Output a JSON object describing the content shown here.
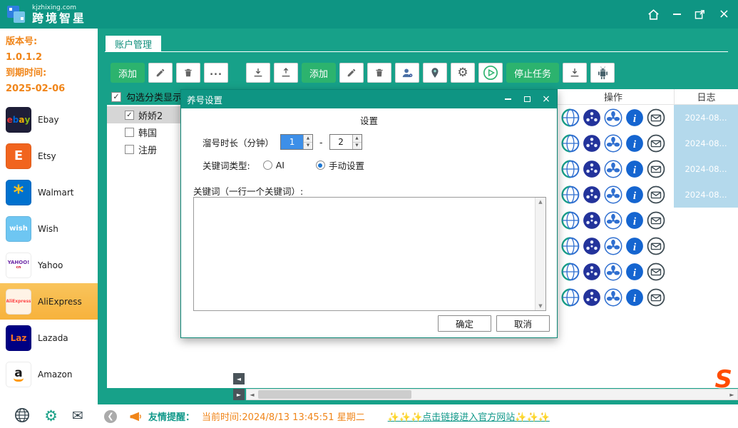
{
  "colors": {
    "teal": "#0e9583",
    "main-bg": "#17a189",
    "green": "#2cb36e",
    "orange": "#f08519",
    "highlight": "#f7b23c",
    "row-date-bg": "#b4d9ec"
  },
  "titlebar": {
    "site": "kjzhixing.com",
    "app_name": "跨境智星"
  },
  "sidebar": {
    "version_label": "版本号:",
    "version": "1.0.1.2",
    "expiry_label": "到期时间:",
    "expiry": "2025-02-06",
    "platforms": [
      {
        "label": "Ebay",
        "icon": "ebay-logo",
        "bg": "#1e1e38",
        "size": 12,
        "letters": [
          [
            "e",
            "#e53238"
          ],
          [
            "b",
            "#0064d2"
          ],
          [
            "a",
            "#f5af02"
          ],
          [
            "y",
            "#86b817"
          ]
        ]
      },
      {
        "label": "Etsy",
        "icon": "etsy-logo",
        "bg": "#f1641e",
        "size": 18,
        "letters": [
          [
            "E",
            "#ffffff"
          ]
        ]
      },
      {
        "label": "Walmart",
        "icon": "walmart-logo",
        "bg": "#0071ce",
        "size": 28,
        "letters": [
          [
            "*",
            "#ffc220"
          ]
        ]
      },
      {
        "label": "Wish",
        "icon": "wish-logo",
        "bg": "#6ec6f2",
        "size": 10,
        "letters": [
          [
            "wish",
            "#ffffff"
          ]
        ]
      },
      {
        "label": "Yahoo",
        "icon": "yahoo-logo",
        "bg": "#ffffff",
        "size": 7,
        "letters": [
          [
            "YAHOO!",
            "#6f2da8"
          ]
        ],
        "sub": [
          "cn",
          "#d0021b"
        ]
      },
      {
        "label": "AliExpress",
        "icon": "aliexpress-logo",
        "bg": "#fff3e6",
        "size": 6,
        "letters": [
          [
            "AliExpress",
            "#ff4747"
          ]
        ],
        "selected": true
      },
      {
        "label": "Lazada",
        "icon": "lazada-logo",
        "bg": "#000083",
        "size": 12,
        "letters": [
          [
            "Laz",
            "#f57224"
          ]
        ]
      },
      {
        "label": "Amazon",
        "icon": "amazon-logo",
        "bg": "#ffffff",
        "size": 17,
        "letters": [
          [
            "a",
            "#1a1a1a"
          ]
        ],
        "smile": true
      }
    ]
  },
  "main": {
    "tab": "账户管理",
    "filter_checkbox_label": "勾选分类显示",
    "toolbar_category": {
      "buttons": [
        {
          "name": "add-category-button",
          "style": "green",
          "label": "添加"
        },
        {
          "name": "edit-category-button",
          "icon": "pencil-icon"
        },
        {
          "name": "delete-category-button",
          "icon": "trash-icon"
        },
        {
          "name": "more-category-button",
          "icon": "more-icon"
        }
      ]
    },
    "toolbar_account": {
      "buttons": [
        {
          "name": "import-button",
          "icon": "download-icon"
        },
        {
          "name": "export-button",
          "icon": "upload-icon"
        },
        {
          "name": "add-account-button",
          "style": "green",
          "label": "添加"
        },
        {
          "name": "edit-account-button",
          "icon": "pencil-icon"
        },
        {
          "name": "delete-account-button",
          "icon": "trash-icon"
        },
        {
          "name": "user-settings-button",
          "icon": "user-gear-icon"
        },
        {
          "name": "location-button",
          "icon": "pin-icon"
        },
        {
          "name": "settings-button",
          "icon": "gear-icon"
        },
        {
          "name": "start-task-button",
          "icon": "play-icon"
        },
        {
          "name": "stop-task-button",
          "style": "green",
          "label": "停止任务"
        },
        {
          "name": "download-button",
          "icon": "download-icon"
        },
        {
          "name": "android-button",
          "icon": "android-icon"
        }
      ]
    },
    "tree": {
      "items": [
        {
          "label": "娇娇2",
          "checked": true,
          "selected": true
        },
        {
          "label": "韩国",
          "checked": false
        },
        {
          "label": "注册",
          "checked": false
        }
      ]
    },
    "table": {
      "columns": [
        "操作",
        "日志"
      ],
      "row_icons": [
        "browser-icon",
        "film-reel-icon",
        "fan-icon",
        "info-icon",
        "mail-icon"
      ],
      "rows": [
        {
          "date": "2024-08..."
        },
        {
          "date": "2024-08..."
        },
        {
          "date": "2024-08..."
        },
        {
          "date": "2024-08..."
        },
        {
          "date": ""
        },
        {
          "date": ""
        },
        {
          "date": ""
        },
        {
          "date": ""
        }
      ]
    }
  },
  "dialog": {
    "title": "养号设置",
    "section_title": "设置",
    "duration_label": "溜号时长（分钟）",
    "duration_min": "1",
    "duration_separator": "-",
    "duration_max": "2",
    "keyword_type_label": "关键词类型:",
    "radio_ai_label": "AI",
    "radio_manual_label": "手动设置",
    "keywords_label": "关键词（一行一个关键词）:",
    "ok_label": "确定",
    "cancel_label": "取消"
  },
  "statusbar": {
    "reminder_label": "友情提醒：",
    "current_time": "当前时间:2024/8/13 13:45:51 星期二",
    "link_text": "✨✨✨点击链接进入官方网站✨✨✨"
  }
}
